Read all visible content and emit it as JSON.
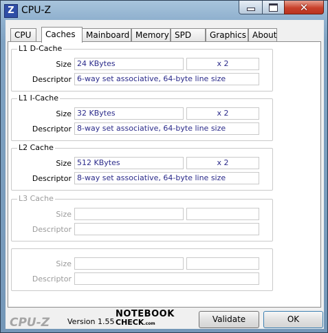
{
  "window": {
    "title": "CPU-Z",
    "icon_letter": "Z",
    "close_glyph": "✕"
  },
  "tabs": [
    {
      "label": "CPU"
    },
    {
      "label": "Caches"
    },
    {
      "label": "Mainboard"
    },
    {
      "label": "Memory"
    },
    {
      "label": "SPD"
    },
    {
      "label": "Graphics"
    },
    {
      "label": "About"
    }
  ],
  "active_tab": "Caches",
  "groups": {
    "l1d": {
      "title": "L1 D-Cache",
      "size_label": "Size",
      "size": "24 KBytes",
      "count": "x 2",
      "descriptor_label": "Descriptor",
      "descriptor": "6-way set associative, 64-byte line size"
    },
    "l1i": {
      "title": "L1 I-Cache",
      "size_label": "Size",
      "size": "32 KBytes",
      "count": "x 2",
      "descriptor_label": "Descriptor",
      "descriptor": "8-way set associative, 64-byte line size"
    },
    "l2": {
      "title": "L2 Cache",
      "size_label": "Size",
      "size": "512 KBytes",
      "count": "x 2",
      "descriptor_label": "Descriptor",
      "descriptor": "8-way set associative, 64-byte line size"
    },
    "l3": {
      "title": "L3 Cache",
      "size_label": "Size",
      "size": "",
      "count": "",
      "descriptor_label": "Descriptor",
      "descriptor": ""
    },
    "extra": {
      "title": "",
      "size_label": "Size",
      "size": "",
      "count": "",
      "descriptor_label": "Descriptor",
      "descriptor": ""
    }
  },
  "footer": {
    "logo": "CPU-Z",
    "version": "Version 1.55",
    "watermark_line1": "NOTEBOOK",
    "watermark_line2": "CHECK",
    "watermark_suffix": ".com",
    "validate_label": "Validate",
    "ok_label": "OK"
  }
}
